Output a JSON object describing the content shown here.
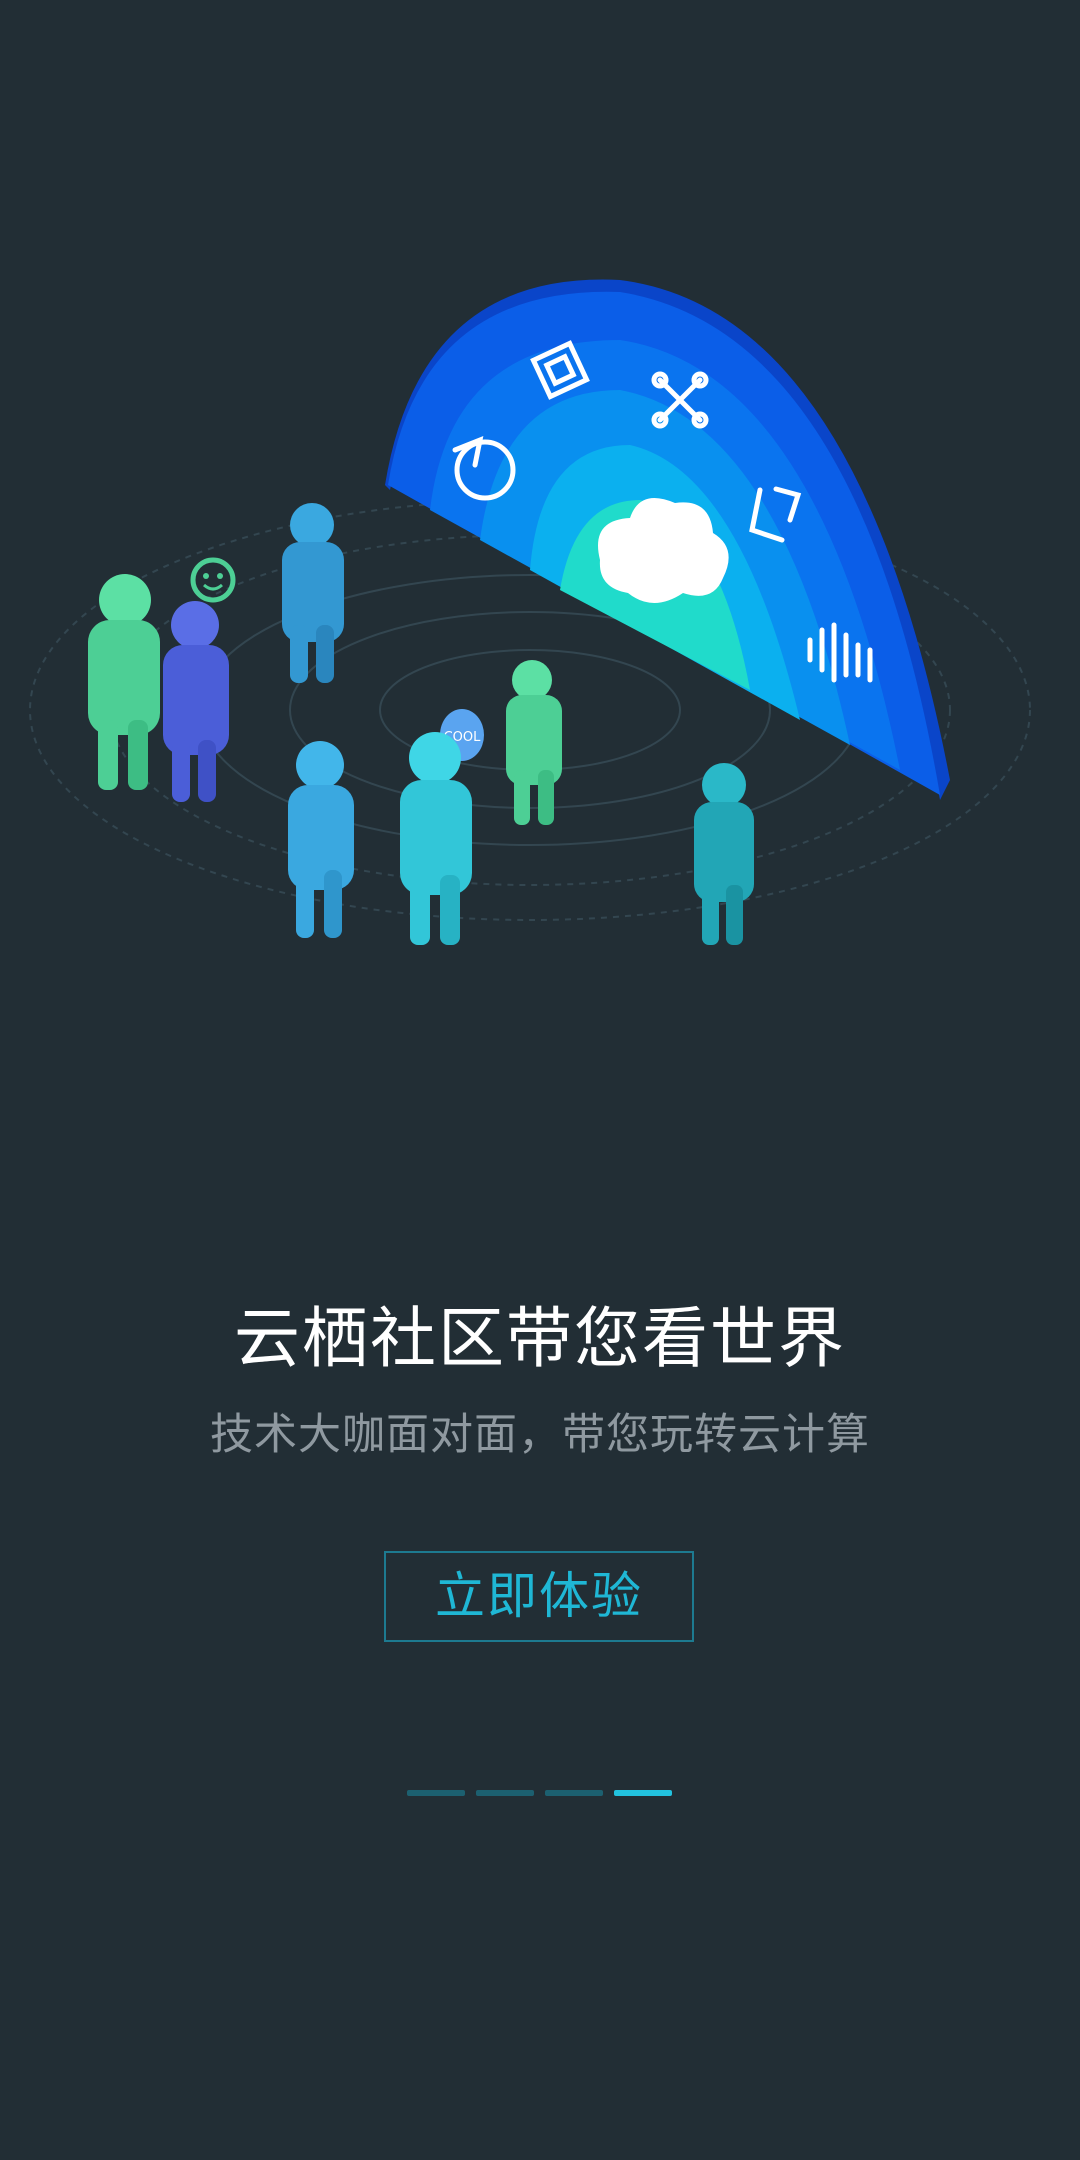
{
  "illustration": {
    "speech_bubble_text": "COOL",
    "icons": [
      "chip-icon",
      "drone-icon",
      "sync-icon",
      "chat-icon",
      "cloud-icon",
      "voice-wave-icon",
      "smile-icon"
    ]
  },
  "headline": "云栖社区带您看世界",
  "subheadline": "技术大咖面对面，带您玩转云计算",
  "cta": {
    "label": "立即体验"
  },
  "pager": {
    "count": 4,
    "active_index": 3
  },
  "colors": {
    "background": "#222e35",
    "accent": "#22c2de",
    "cta_border": "#1d7a90",
    "subtitle": "#8f99a0"
  }
}
